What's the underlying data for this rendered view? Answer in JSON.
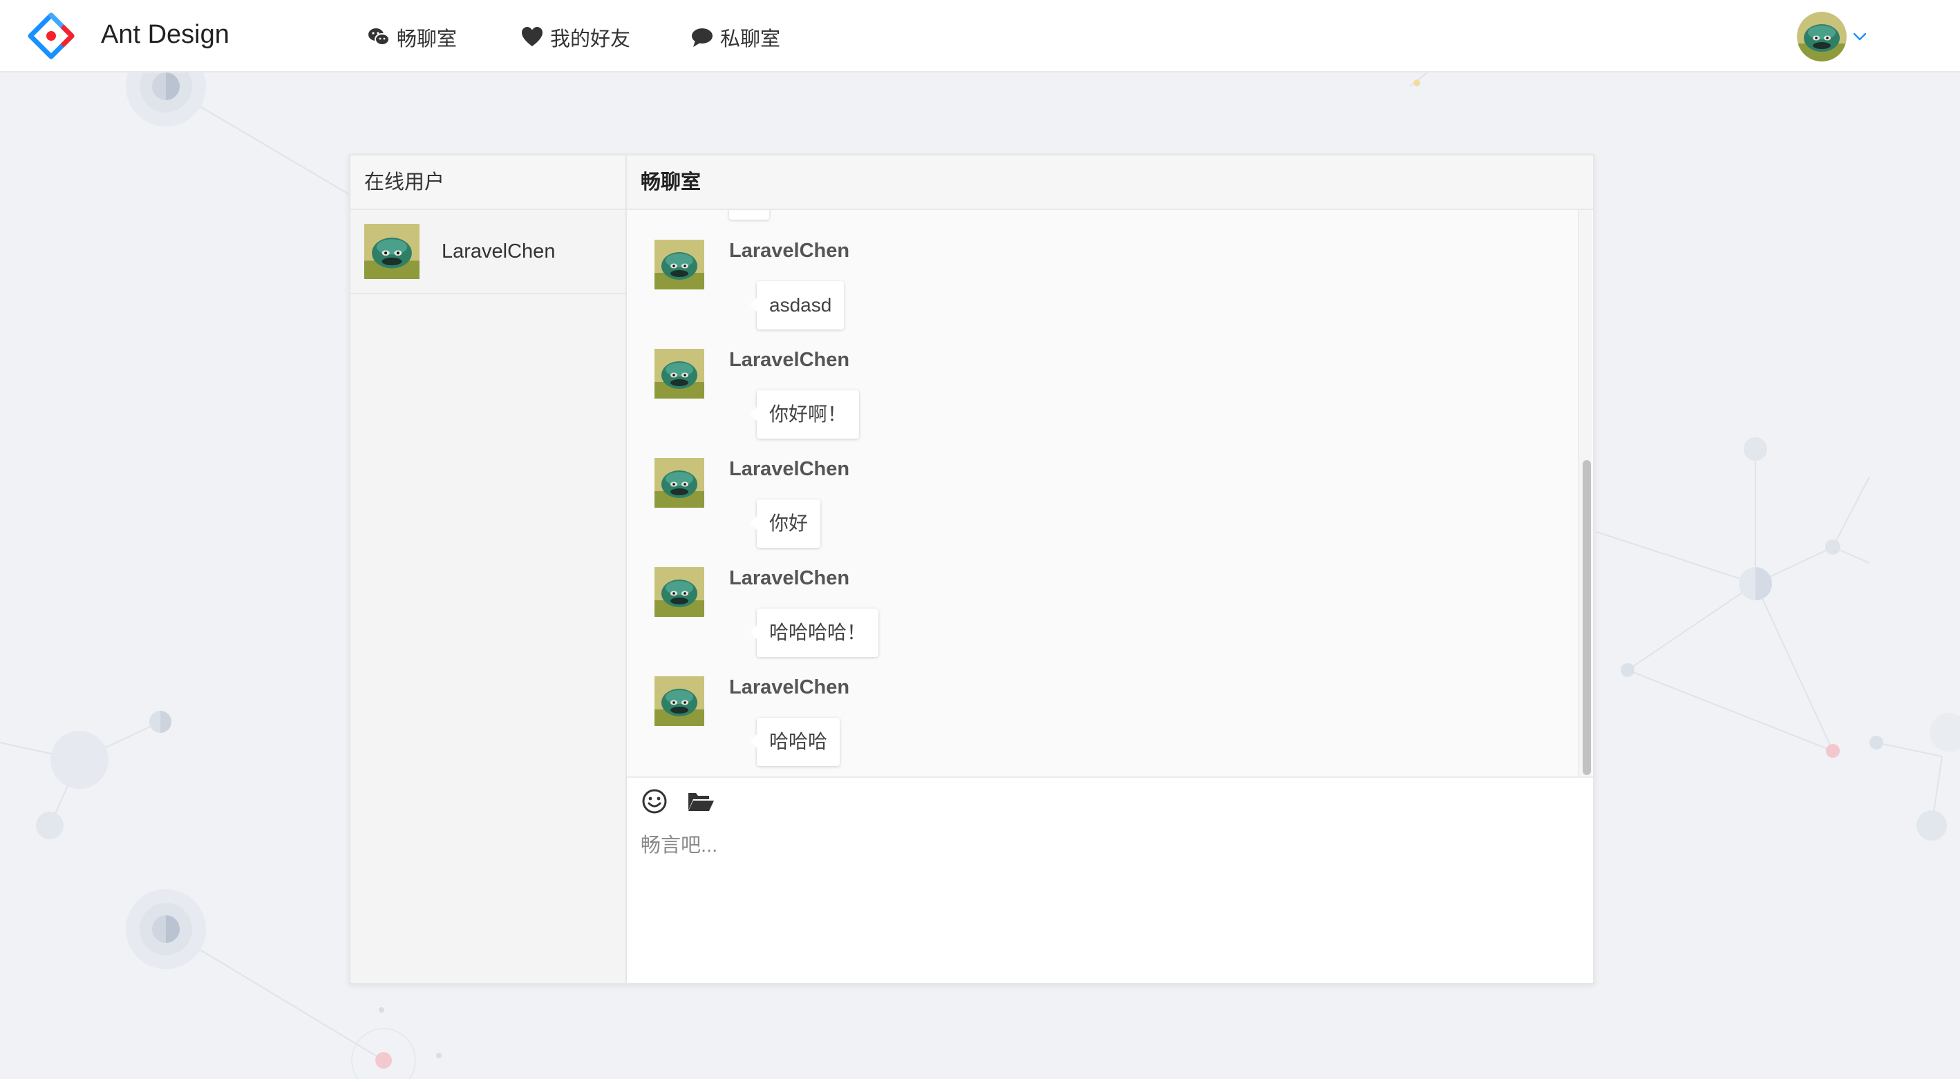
{
  "header": {
    "brand": "Ant Design",
    "nav": [
      {
        "label": "畅聊室",
        "icon": "wechat-icon"
      },
      {
        "label": "我的好友",
        "icon": "heart-icon"
      },
      {
        "label": "私聊室",
        "icon": "comment-icon"
      }
    ],
    "user_menu_icon": "chevron-down-icon"
  },
  "sidebar": {
    "title": "在线用户",
    "users": [
      {
        "name": "LaravelChen"
      }
    ]
  },
  "chat": {
    "title": "畅聊室",
    "messages": [
      {
        "author": "LaravelChen",
        "text": "asdasd"
      },
      {
        "author": "LaravelChen",
        "text": "你好啊！"
      },
      {
        "author": "LaravelChen",
        "text": "你好"
      },
      {
        "author": "LaravelChen",
        "text": "哈哈哈哈！"
      },
      {
        "author": "LaravelChen",
        "text": "哈哈哈"
      }
    ],
    "toolbar": {
      "emoji_icon": "smile-icon",
      "file_icon": "folder-open-icon"
    },
    "input_placeholder": "畅言吧..."
  },
  "colors": {
    "page_bg": "#f0f2f5",
    "brand_blue": "#1890ff",
    "brand_red": "#f5222d"
  }
}
